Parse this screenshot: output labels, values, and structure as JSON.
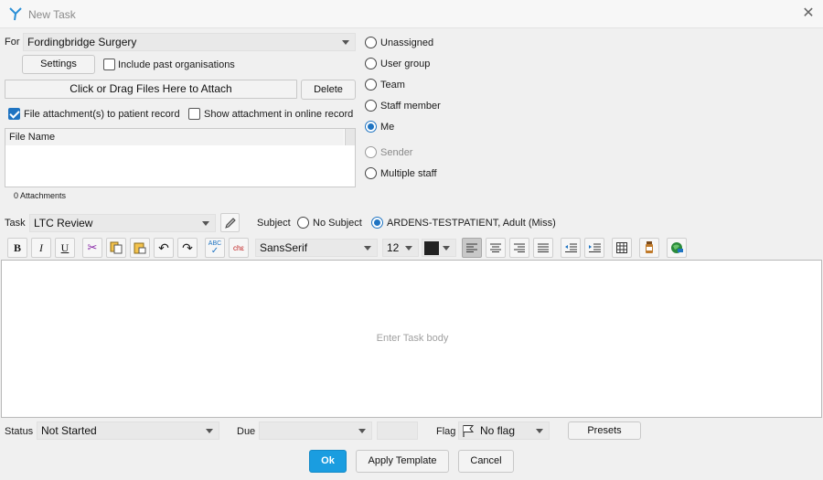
{
  "window": {
    "title": "New Task"
  },
  "for": {
    "label": "For",
    "value": "Fordingbridge Surgery",
    "settings_label": "Settings",
    "include_past_label": "Include past organisations",
    "include_past_checked": false
  },
  "attach": {
    "drop_label": "Click or Drag Files Here to Attach",
    "delete_label": "Delete",
    "file_to_record_label": "File attachment(s) to patient record",
    "file_to_record_checked": true,
    "show_online_label": "Show attachment in online record",
    "show_online_checked": false,
    "column_file_name": "File Name",
    "count_text": "0 Attachments"
  },
  "assign": {
    "options": [
      {
        "label": "Unassigned",
        "selected": false,
        "disabled": false
      },
      {
        "label": "User group",
        "selected": false,
        "disabled": false
      },
      {
        "label": "Team",
        "selected": false,
        "disabled": false
      },
      {
        "label": "Staff member",
        "selected": false,
        "disabled": false
      },
      {
        "label": "Me",
        "selected": true,
        "disabled": false
      },
      {
        "label": "Sender",
        "selected": false,
        "disabled": true
      },
      {
        "label": "Multiple staff",
        "selected": false,
        "disabled": false
      }
    ]
  },
  "task": {
    "label": "Task",
    "value": "LTC Review",
    "subject_label": "Subject",
    "no_subject_label": "No Subject",
    "patient_label": "ARDENS-TESTPATIENT, Adult (Miss)"
  },
  "format": {
    "font_family": "SansSerif",
    "font_size": "12",
    "text_color": "#222222",
    "bold": "B",
    "italic": "I",
    "underline": "U",
    "spell": "ABC",
    "check": "chε"
  },
  "body": {
    "placeholder": "Enter Task body"
  },
  "footer": {
    "status_label": "Status",
    "status_value": "Not Started",
    "due_label": "Due",
    "due_value": "",
    "time_value": "",
    "flag_label": "Flag",
    "flag_value": "No flag",
    "presets_label": "Presets",
    "ok_label": "Ok",
    "apply_template_label": "Apply Template",
    "cancel_label": "Cancel"
  },
  "colors": {
    "accent": "#1f74c2",
    "ok_button": "#1a9de0"
  }
}
